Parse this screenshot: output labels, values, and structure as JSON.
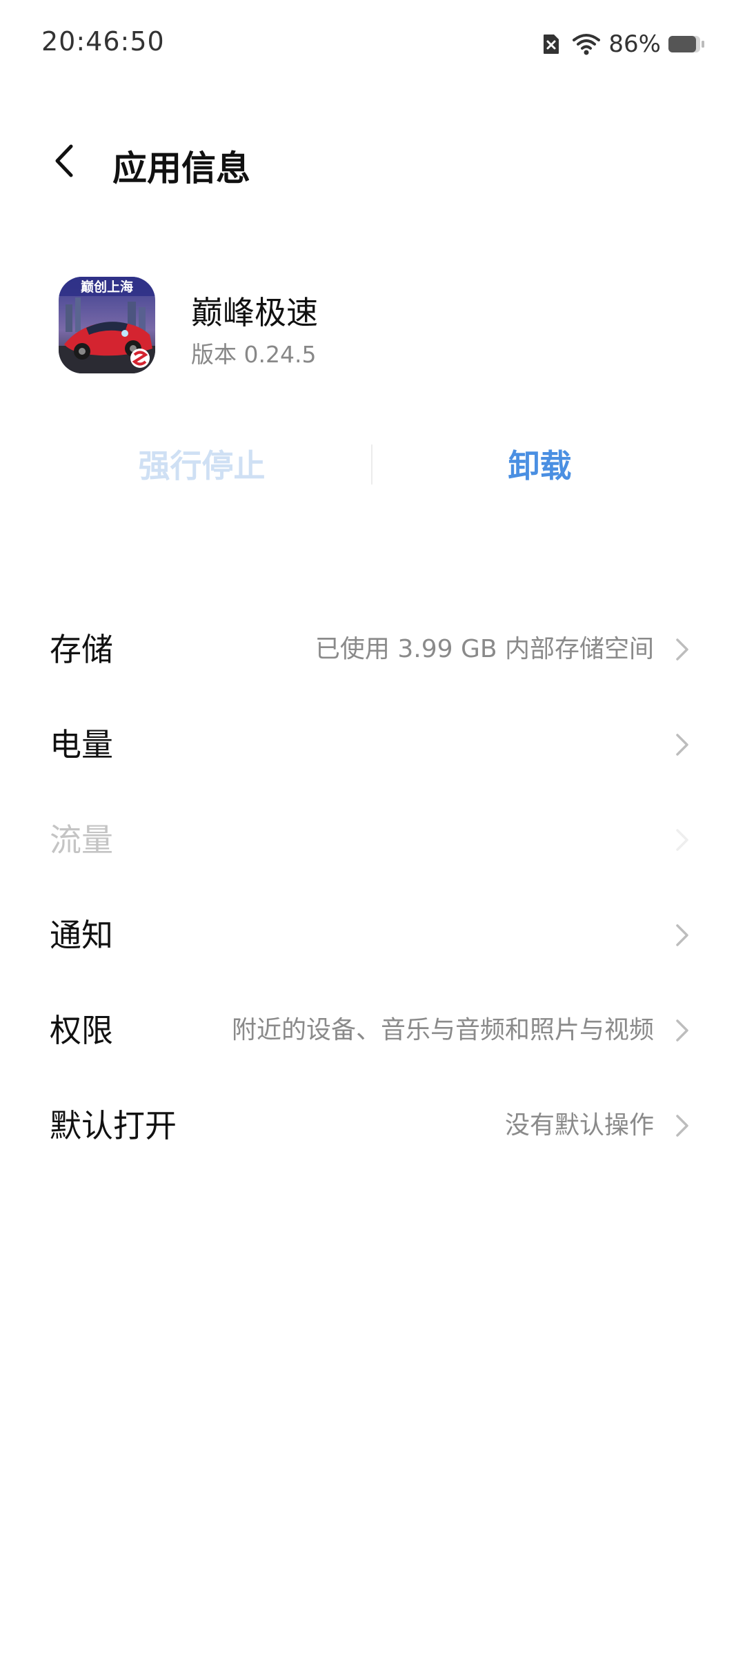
{
  "status_bar": {
    "time": "20:46:50",
    "battery_percent": "86%",
    "battery_level": 0.86,
    "icons": [
      "sim-error-icon",
      "wifi-icon",
      "battery-icon"
    ]
  },
  "header": {
    "title": "应用信息",
    "back_icon": "chevron-left-icon"
  },
  "app": {
    "name": "巅峰极速",
    "version": "版本 0.24.5",
    "icon_banner": "巅创上海"
  },
  "actions": {
    "force_stop_label": "强行停止",
    "force_stop_enabled": false,
    "uninstall_label": "卸载",
    "uninstall_color": "#4a8fe2"
  },
  "settings": {
    "items": [
      {
        "label": "存储",
        "value": "已使用 3.99 GB 内部存储空间",
        "enabled": true
      },
      {
        "label": "电量",
        "value": "",
        "enabled": true
      },
      {
        "label": "流量",
        "value": "",
        "enabled": false
      },
      {
        "label": "通知",
        "value": "",
        "enabled": true
      },
      {
        "label": "权限",
        "value": "附近的设备、音乐与音频和照片与视频",
        "enabled": true
      },
      {
        "label": "默认打开",
        "value": "没有默认操作",
        "enabled": true
      }
    ]
  }
}
